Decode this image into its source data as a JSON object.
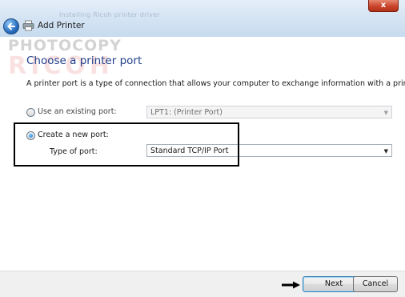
{
  "window": {
    "close_label": "x",
    "title_ghost": "Installing Ricoh printer driver"
  },
  "header": {
    "title": "Add Printer"
  },
  "watermark": {
    "line1": "PHOTOCOPY",
    "line2": "RICOH"
  },
  "page": {
    "heading": "Choose a printer port",
    "description": "A printer port is a type of connection that allows your computer to exchange information with a printer."
  },
  "options": {
    "existing": {
      "label": "Use an existing port:",
      "value": "LPT1: (Printer Port)",
      "selected": false
    },
    "new": {
      "label": "Create a new port:",
      "type_label": "Type of port:",
      "value": "Standard TCP/IP Port",
      "selected": true
    }
  },
  "footer": {
    "next_label": "Next",
    "cancel_label": "Cancel"
  },
  "colors": {
    "heading": "#1f3f8a",
    "highlight_border": "#000000",
    "default_button_border": "#3c7fb1"
  }
}
